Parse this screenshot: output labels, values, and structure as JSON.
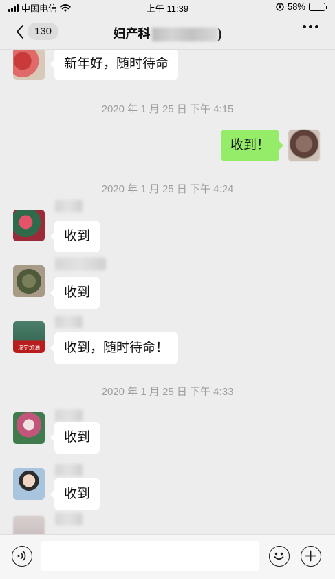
{
  "status_bar": {
    "carrier": "中国电信",
    "time": "上午 11:39",
    "battery": "58%",
    "battery_level": 0.58
  },
  "nav": {
    "unread_count": "130",
    "title": "妇产科",
    "title_suffix": ")"
  },
  "messages": [
    {
      "side": "in",
      "text": "新年好，随时待命"
    },
    {
      "side": "time",
      "text": "2020 年 1 月 25 日  下午 4:15"
    },
    {
      "side": "out",
      "text": "收到！"
    },
    {
      "side": "time",
      "text": "2020 年 1 月 25 日  下午 4:24"
    },
    {
      "side": "in",
      "text": "收到"
    },
    {
      "side": "in",
      "text": "收到"
    },
    {
      "side": "in",
      "text": "收到，随时待命！"
    },
    {
      "side": "time",
      "text": "2020 年 1 月 25 日  下午 4:33"
    },
    {
      "side": "in",
      "text": "收到"
    },
    {
      "side": "in",
      "text": "收到"
    }
  ],
  "avatar_caption": "遂宁加油",
  "icons": {
    "back": "chevron-left-icon",
    "more": "more-dots-icon",
    "voice": "voice-icon",
    "emoji": "emoji-icon",
    "plus": "plus-icon"
  },
  "colors": {
    "background": "#ededed",
    "outgoing_bubble": "#95ec69",
    "incoming_bubble": "#ffffff",
    "timestamp_text": "#9e9e9e"
  }
}
